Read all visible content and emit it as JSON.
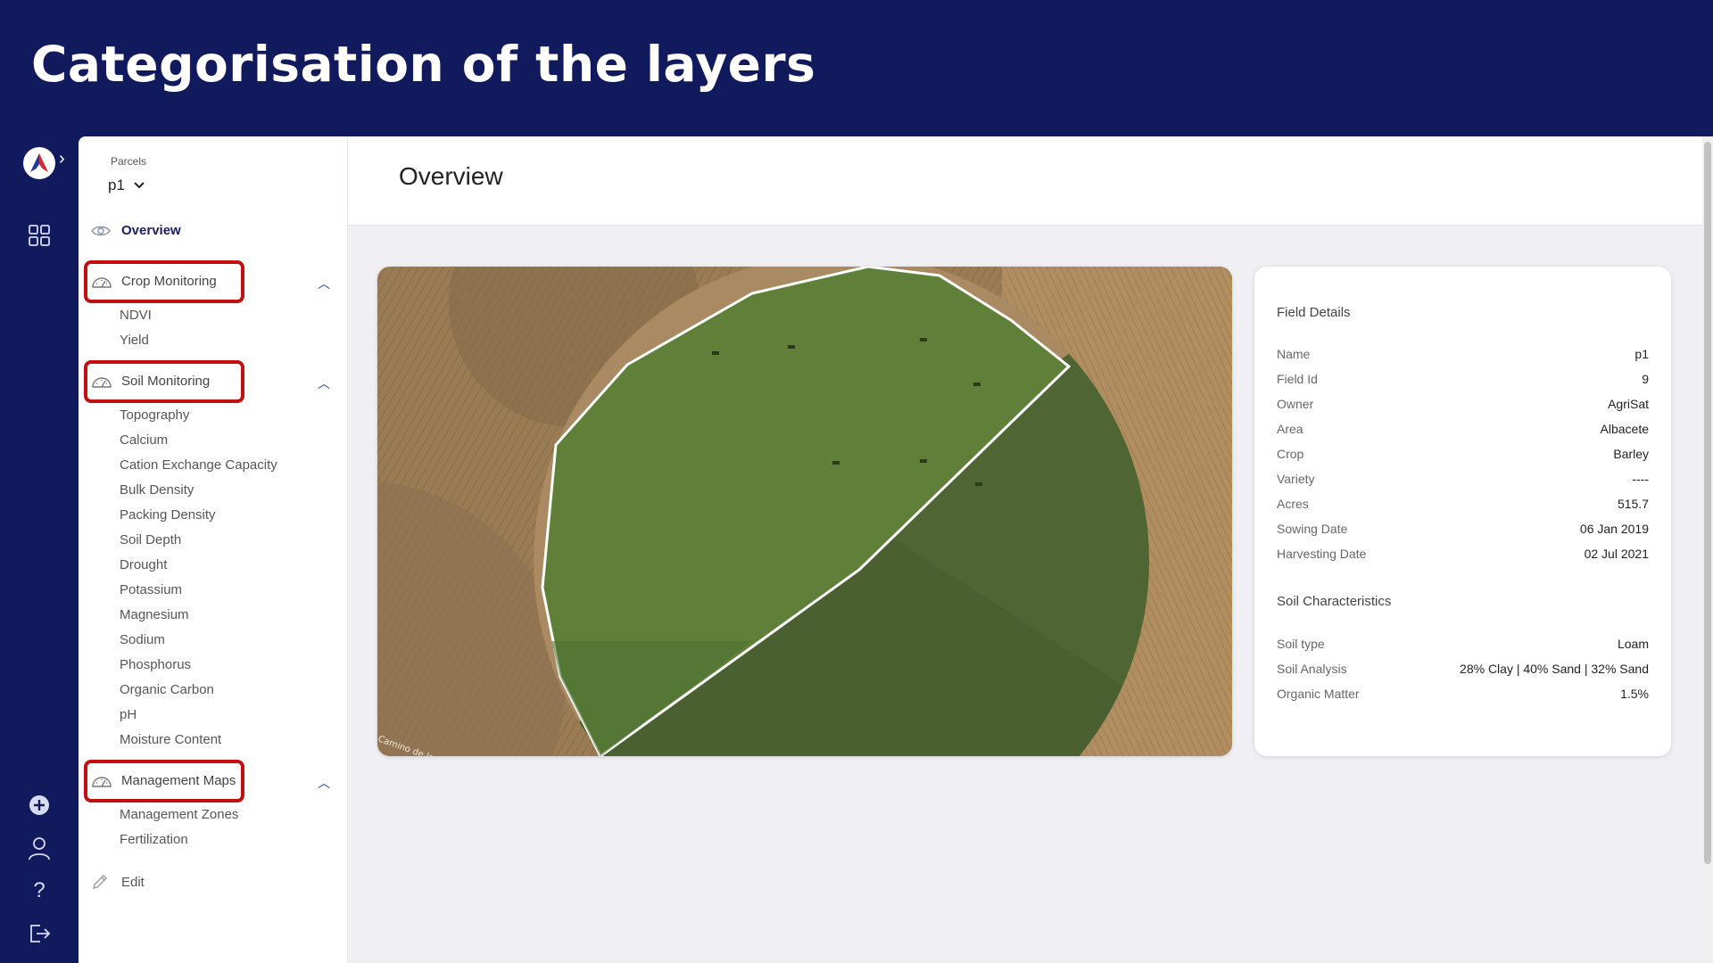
{
  "banner": {
    "title": "Categorisation of the layers"
  },
  "rail": {
    "icons": [
      "app-logo",
      "expand-chevron-icon",
      "grid-icon",
      "add-icon",
      "user-icon",
      "help-icon",
      "logout-icon"
    ]
  },
  "sidebar": {
    "parcels_label": "Parcels",
    "parcel_value": "p1",
    "overview_label": "Overview",
    "groups": [
      {
        "label": "Crop Monitoring",
        "items": [
          "NDVI",
          "Yield"
        ]
      },
      {
        "label": "Soil Monitoring",
        "items": [
          "Topography",
          "Calcium",
          "Cation Exchange Capacity",
          "Bulk Density",
          "Packing Density",
          "Soil Depth",
          "Drought",
          "Potassium",
          "Magnesium",
          "Sodium",
          "Phosphorus",
          "Organic Carbon",
          "pH",
          "Moisture Content"
        ]
      },
      {
        "label": "Management Maps",
        "items": [
          "Management Zones",
          "Fertilization"
        ]
      }
    ],
    "edit_label": "Edit"
  },
  "main": {
    "title": "Overview",
    "map": {
      "attribution": "Camino de la Mata"
    },
    "field_details": {
      "title": "Field Details",
      "rows": [
        {
          "label": "Name",
          "value": "p1"
        },
        {
          "label": "Field Id",
          "value": "9"
        },
        {
          "label": "Owner",
          "value": "AgriSat"
        },
        {
          "label": "Area",
          "value": "Albacete"
        },
        {
          "label": "Crop",
          "value": "Barley"
        },
        {
          "label": "Variety",
          "value": "----"
        },
        {
          "label": "Acres",
          "value": "515.7"
        },
        {
          "label": "Sowing Date",
          "value": "06 Jan 2019"
        },
        {
          "label": "Harvesting Date",
          "value": "02 Jul 2021"
        }
      ]
    },
    "soil_characteristics": {
      "title": "Soil Characteristics",
      "rows": [
        {
          "label": "Soil type",
          "value": "Loam"
        },
        {
          "label": "Soil Analysis",
          "value": "28% Clay | 40% Sand | 32% Sand"
        },
        {
          "label": "Organic Matter",
          "value": "1.5%"
        }
      ]
    }
  },
  "colors": {
    "brand_navy": "#121a5e",
    "highlight_red": "#c01010",
    "accent_blue": "#1a4aa0"
  }
}
